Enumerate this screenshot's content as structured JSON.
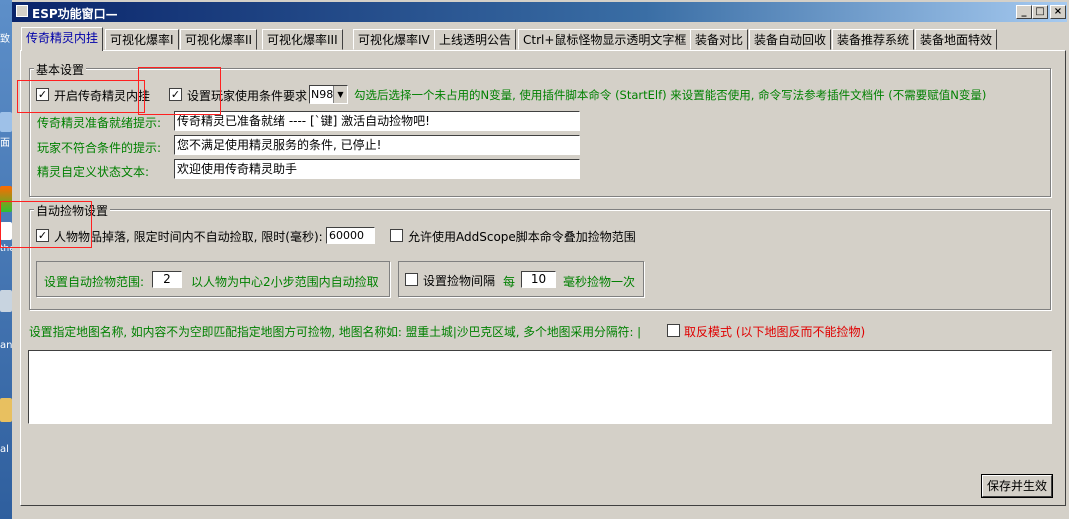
{
  "desktop": {
    "labels": [
      "致",
      "面",
      "the",
      "an",
      "al"
    ]
  },
  "window": {
    "title": "ESP功能窗口—"
  },
  "tabs": [
    "传奇精灵内挂",
    "可视化爆率I",
    "可视化爆率II",
    "可视化爆率III",
    "可视化爆率IV",
    "上线透明公告",
    "Ctrl+鼠标怪物显示透明文字框",
    "装备对比",
    "装备自动回收",
    "装备推荐系统",
    "装备地面特效"
  ],
  "basic": {
    "legend": "基本设置",
    "enable_label": "开启传奇精灵内挂",
    "enable_checked": true,
    "player_req_label": "设置玩家使用条件要求",
    "player_req_checked": true,
    "var_select": "N98",
    "hint": "勾选后选择一个未占用的N变量, 使用插件脚本命令 (StartElf) 来设置能否使用, 命令写法参考插件文档件 (不需要赋值N变量)",
    "ready_label": "传奇精灵准备就绪提示:",
    "ready_value": "传奇精灵已准备就绪 ---- [`键] 激活自动捡物吧!",
    "notmet_label": "玩家不符合条件的提示:",
    "notmet_value": "您不满足使用精灵服务的条件, 已停止!",
    "custom_label": "精灵自定义状态文本:",
    "custom_value": "欢迎使用传奇精灵助手"
  },
  "pickup": {
    "legend": "自动捡物设置",
    "drop_label": "人物物品掉落, 限定时间内不自动捡取, 限时(毫秒):",
    "drop_checked": true,
    "drop_ms": "60000",
    "addscope_label": "允许使用AddScope脚本命令叠加捡物范围",
    "addscope_checked": false,
    "range_label": "设置自动捡物范围:",
    "range_value": "2",
    "range_suffix": "以人物为中心2小步范围内自动捡取",
    "interval_label": "设置捡物间隔",
    "interval_checked": false,
    "interval_every": "每",
    "interval_value": "10",
    "interval_suffix": "毫秒捡物一次"
  },
  "map": {
    "hint": "设置指定地图名称, 如内容不为空即匹配指定地图方可捡物, 地图名称如: 盟重土城|沙巴克区域, 多个地图采用分隔符: |",
    "reverse_label": "取反模式 (以下地图反而不能捡物)",
    "reverse_checked": false,
    "textarea_value": ""
  },
  "save_button": "保存并生效",
  "colors": {
    "label_green": "#008000",
    "reverse_red": "#e00000",
    "active_tab": "#0000aa",
    "annotation": "#ff2020"
  }
}
